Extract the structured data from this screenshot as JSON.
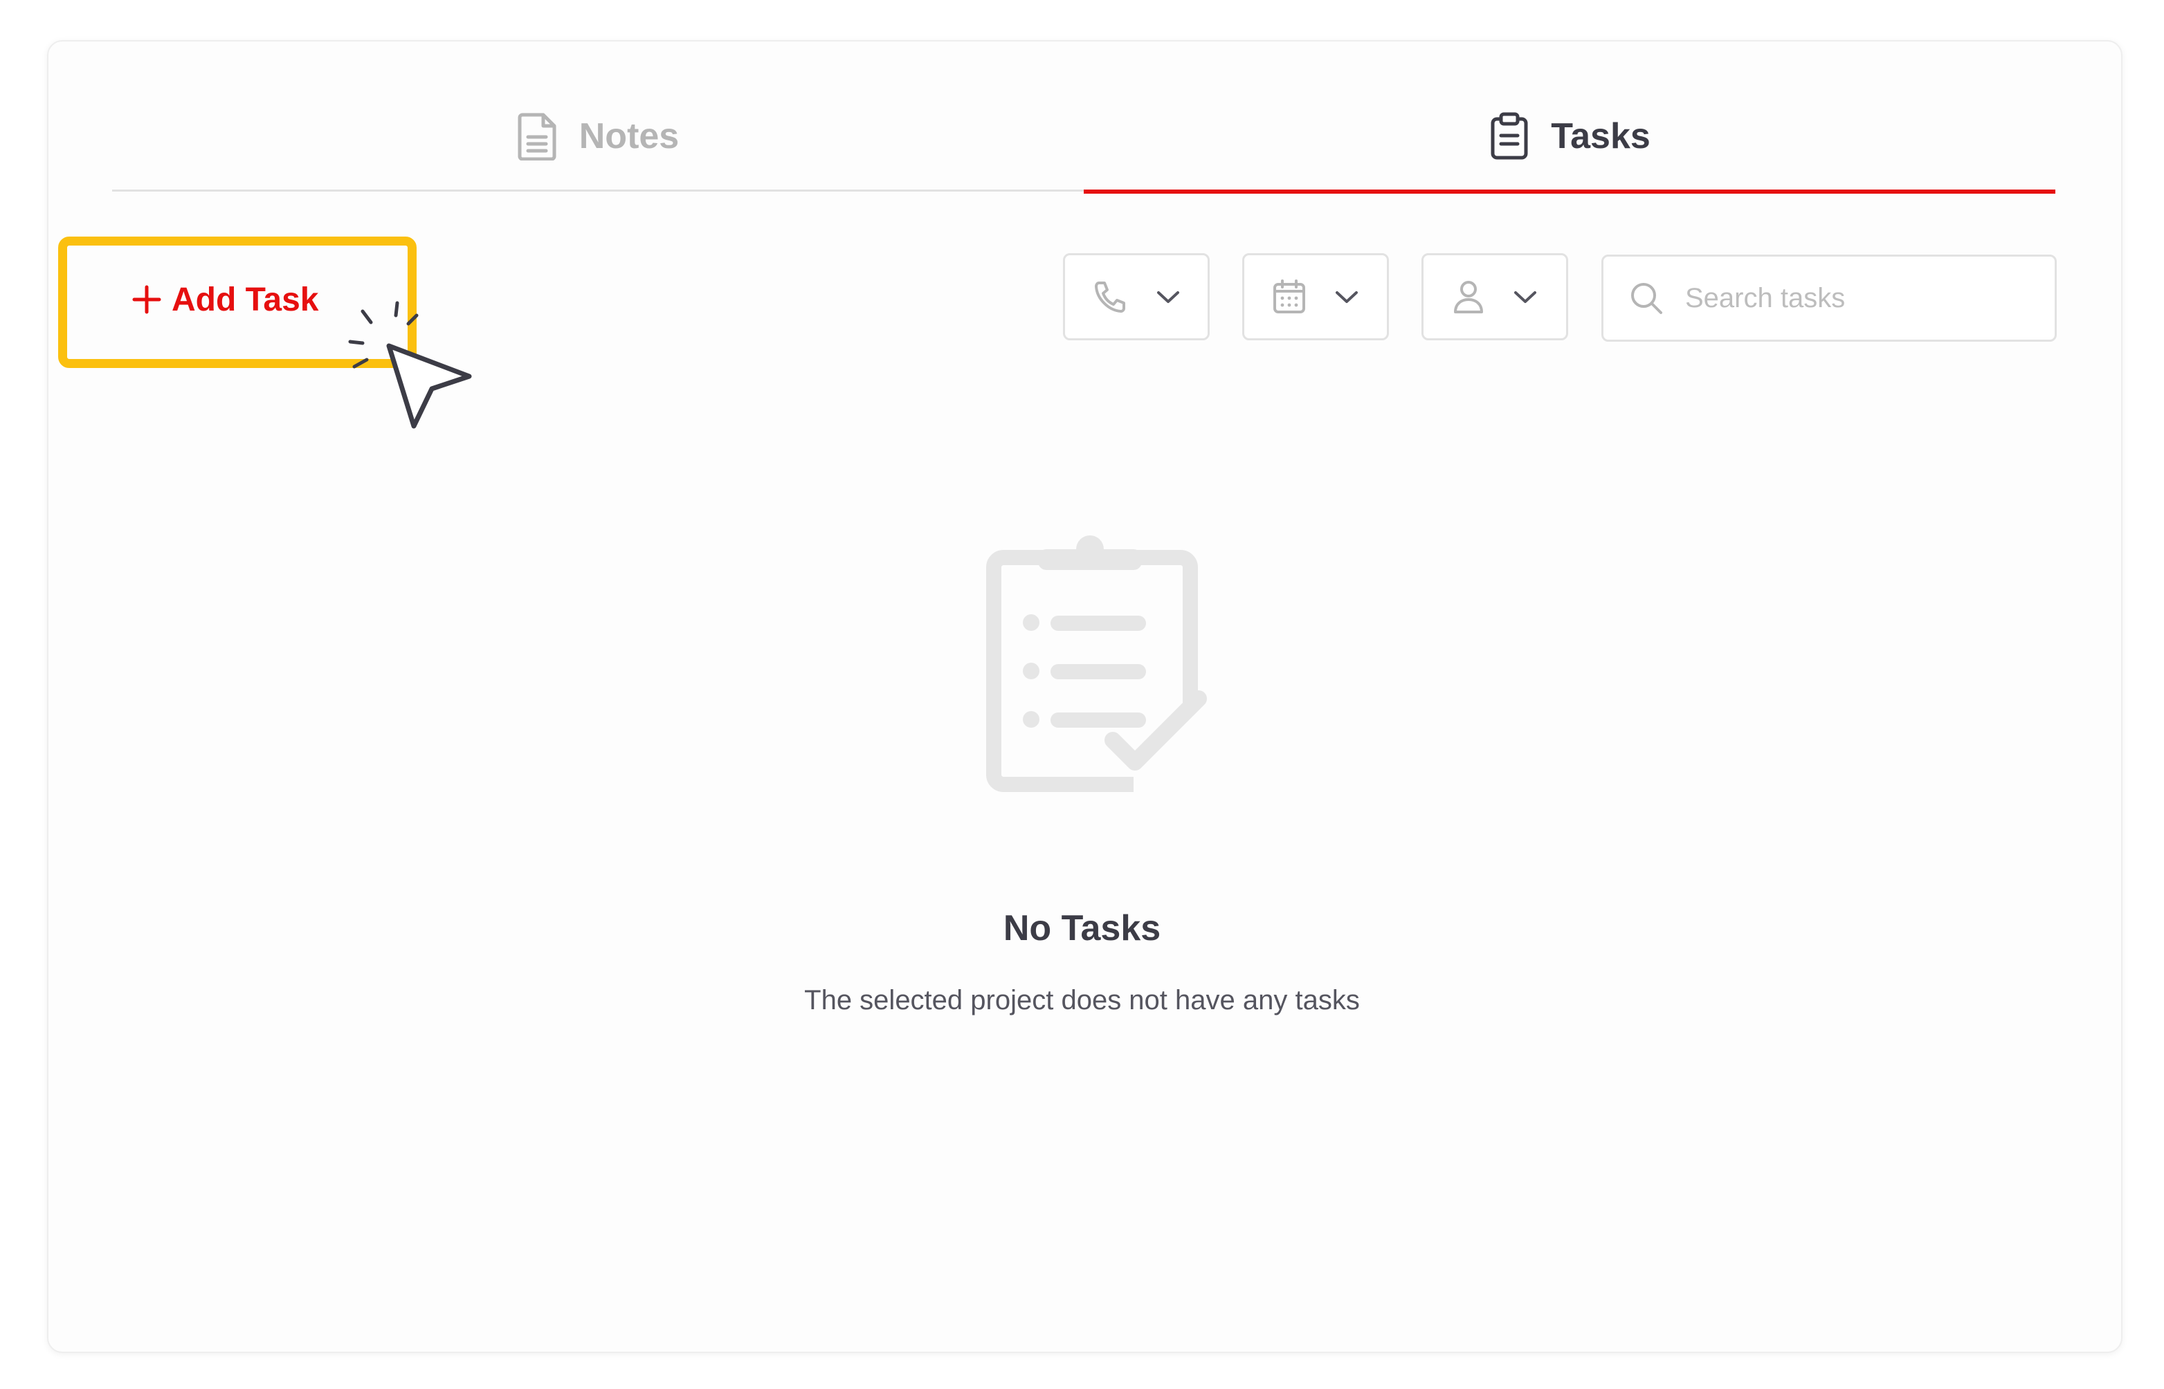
{
  "tabs": [
    {
      "label": "Notes",
      "icon": "document-icon",
      "active": false
    },
    {
      "label": "Tasks",
      "icon": "clipboard-icon",
      "active": true
    }
  ],
  "toolbar": {
    "add_label": "Add Task",
    "filters": [
      {
        "icon": "phone-icon",
        "value": ""
      },
      {
        "icon": "calendar-icon",
        "value": ""
      },
      {
        "icon": "user-icon",
        "value": ""
      }
    ],
    "search": {
      "placeholder": "Search tasks",
      "value": ""
    }
  },
  "empty_state": {
    "title": "No Tasks",
    "subtitle": "The selected project does not have any tasks"
  },
  "colors": {
    "accent": "#e60f0f",
    "highlight": "#fbc00f",
    "text_dark": "#3c3c46",
    "muted": "#b5b5b5",
    "border": "#e2e2e2"
  }
}
